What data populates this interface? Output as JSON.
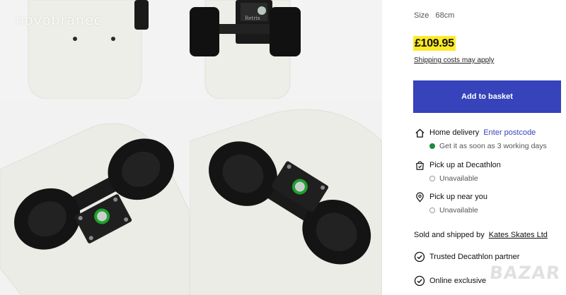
{
  "gallery": {
    "watermark": "novobranec",
    "images": [
      {
        "alt": "Skateboard deck underside top"
      },
      {
        "alt": "Skateboard truck and wheels close-up"
      },
      {
        "alt": "Skateboard truck angled left"
      },
      {
        "alt": "Skateboard truck angled right"
      }
    ],
    "truck_brand": "Retrix"
  },
  "product": {
    "size_label": "Size",
    "size_value": "68cm",
    "price": "£109.95",
    "shipping_link": "Shipping costs may apply",
    "add_button": "Add to basket"
  },
  "delivery": {
    "home": {
      "title": "Home delivery",
      "link": "Enter postcode",
      "status": "Get it as soon as 3 working days",
      "icon": "home-icon"
    },
    "pickup_store": {
      "title": "Pick up at Decathlon",
      "status": "Unavailable",
      "icon": "store-bag-icon"
    },
    "pickup_near": {
      "title": "Pick up near you",
      "status": "Unavailable",
      "icon": "location-pin-icon"
    }
  },
  "seller": {
    "prefix": "Sold and shipped by",
    "name": "Kates Skates Ltd"
  },
  "features": [
    {
      "label": "Trusted Decathlon partner",
      "icon": "check-circle-icon"
    },
    {
      "label": "Online exclusive",
      "icon": "check-circle-icon"
    }
  ],
  "corner_watermark": "BAZAR",
  "colors": {
    "price_highlight": "#ffea28",
    "button": "#3643ba",
    "link": "#3643ba",
    "available": "#1c8a3c"
  }
}
